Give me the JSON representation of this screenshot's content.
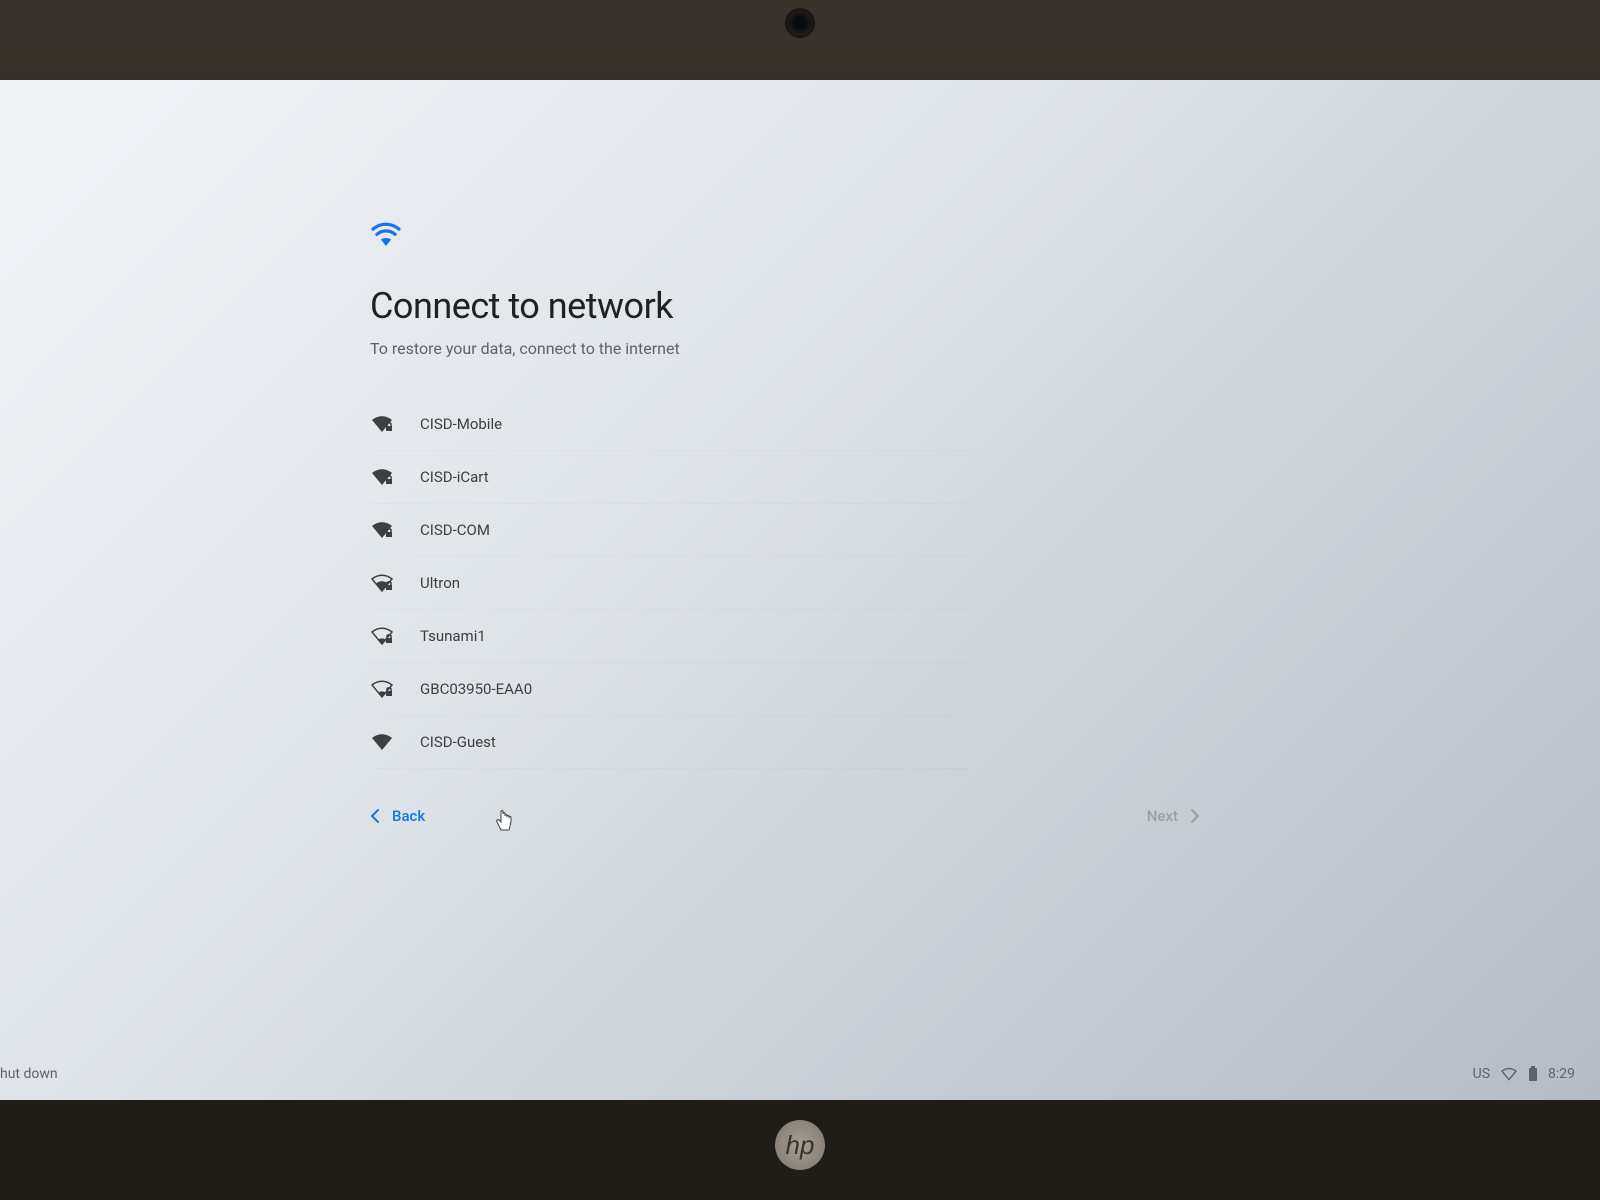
{
  "header": {
    "title": "Connect to network",
    "subtitle": "To restore your data, connect to the internet"
  },
  "networks": [
    {
      "name": "CISD-Mobile",
      "strength": "strong",
      "secured": true
    },
    {
      "name": "CISD-iCart",
      "strength": "strong",
      "secured": true
    },
    {
      "name": "CISD-COM",
      "strength": "strong",
      "secured": true
    },
    {
      "name": "Ultron",
      "strength": "medium",
      "secured": true
    },
    {
      "name": "Tsunami1",
      "strength": "weak",
      "secured": true
    },
    {
      "name": "GBC03950-EAA0",
      "strength": "weak",
      "secured": true
    },
    {
      "name": "CISD-Guest",
      "strength": "strong",
      "secured": false
    }
  ],
  "buttons": {
    "back": "Back",
    "next": "Next"
  },
  "statusBar": {
    "keyboard": "US",
    "time": "8:29",
    "shutdown": "hut down"
  }
}
